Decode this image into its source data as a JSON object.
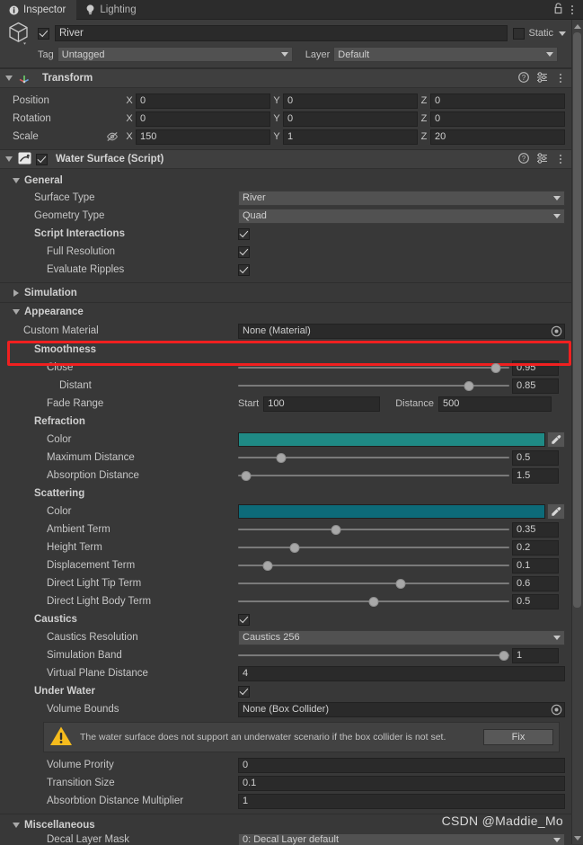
{
  "tabs": [
    {
      "label": "Inspector",
      "icon": "info-icon",
      "active": true
    },
    {
      "label": "Lighting",
      "icon": "bulb-icon",
      "active": false
    }
  ],
  "tabbar": {
    "lock_icon": "lock-icon",
    "menu_icon": "kebab-menu-icon"
  },
  "object_header": {
    "icon": "gameobject-cube-icon",
    "enabled": true,
    "name": "River",
    "static_label": "Static",
    "static_checked": false,
    "tag_label": "Tag",
    "tag_value": "Untagged",
    "layer_label": "Layer",
    "layer_value": "Default"
  },
  "transform": {
    "title": "Transform",
    "icon": "transform-axes-icon",
    "help_icon": "help-icon",
    "preset_icon": "preset-icon",
    "menu_icon": "kebab-menu-icon",
    "rows": [
      {
        "label": "Position",
        "x": "0",
        "y": "0",
        "z": "0",
        "locked_icon": false
      },
      {
        "label": "Rotation",
        "x": "0",
        "y": "0",
        "z": "0",
        "locked_icon": false
      },
      {
        "label": "Scale",
        "x": "150",
        "y": "1",
        "z": "20",
        "locked_icon": true
      }
    ],
    "axes": [
      "X",
      "Y",
      "Z"
    ]
  },
  "water_surface": {
    "title": "Water Surface (Script)",
    "icon": "script-icon",
    "enabled": true,
    "help_icon": "help-icon",
    "preset_icon": "preset-icon",
    "menu_icon": "kebab-menu-icon"
  },
  "sections": {
    "general": {
      "label": "General",
      "expanded": true,
      "surface_type": {
        "label": "Surface Type",
        "value": "River"
      },
      "geometry_type": {
        "label": "Geometry Type",
        "value": "Quad"
      },
      "script_interactions": {
        "label": "Script Interactions",
        "checked": true
      },
      "full_resolution": {
        "label": "Full Resolution",
        "checked": true
      },
      "evaluate_ripples": {
        "label": "Evaluate Ripples",
        "checked": true
      }
    },
    "simulation": {
      "label": "Simulation",
      "expanded": false
    },
    "appearance": {
      "label": "Appearance",
      "expanded": true,
      "custom_material": {
        "label": "Custom Material",
        "value": "None (Material)",
        "highlighted": true
      },
      "smoothness": {
        "label": "Smoothness",
        "close": {
          "label": "Close",
          "value": "0.95",
          "percent": 95
        },
        "distant": {
          "label": "Distant",
          "value": "0.85",
          "percent": 85
        },
        "fade_range": {
          "label": "Fade Range",
          "start_label": "Start",
          "start_value": "100",
          "distance_label": "Distance",
          "distance_value": "500"
        }
      },
      "refraction": {
        "label": "Refraction",
        "color": {
          "label": "Color",
          "hex": "#1f8a85",
          "eyedropper_icon": "eyedropper-icon"
        },
        "maximum_distance": {
          "label": "Maximum Distance",
          "value": "0.5",
          "percent": 16
        },
        "absorption_distance": {
          "label": "Absorption Distance",
          "value": "1.5",
          "percent": 3
        }
      },
      "scattering": {
        "label": "Scattering",
        "color": {
          "label": "Color",
          "hex": "#0d6b79",
          "eyedropper_icon": "eyedropper-icon"
        },
        "ambient_term": {
          "label": "Ambient Term",
          "value": "0.35",
          "percent": 36
        },
        "height_term": {
          "label": "Height Term",
          "value": "0.2",
          "percent": 21
        },
        "displacement_term": {
          "label": "Displacement Term",
          "value": "0.1",
          "percent": 11
        },
        "direct_light_tip_term": {
          "label": "Direct Light Tip Term",
          "value": "0.6",
          "percent": 60
        },
        "direct_light_body_term": {
          "label": "Direct Light Body Term",
          "value": "0.5",
          "percent": 50
        }
      },
      "caustics": {
        "label": "Caustics",
        "checked": true,
        "resolution": {
          "label": "Caustics Resolution",
          "value": "Caustics 256"
        },
        "simulation_band": {
          "label": "Simulation Band",
          "value": "1",
          "percent": 98
        },
        "virtual_plane_distance": {
          "label": "Virtual Plane Distance",
          "value": "4"
        }
      },
      "under_water": {
        "label": "Under Water",
        "checked": true,
        "volume_bounds": {
          "label": "Volume Bounds",
          "value": "None (Box Collider)"
        },
        "warning": {
          "icon": "warning-icon",
          "text": "The water surface does not support an underwater scenario if the box collider is not set.",
          "button_label": "Fix"
        },
        "volume_priority": {
          "label": "Volume Prority",
          "value": "0"
        },
        "transition_size": {
          "label": "Transition Size",
          "value": "0.1"
        },
        "absorption_distance_multiplier": {
          "label": "Absorbtion Distance Multiplier",
          "value": "1"
        }
      }
    },
    "miscellaneous": {
      "label": "Miscellaneous",
      "expanded": true,
      "decal_layer_mask": {
        "label": "Decal Layer Mask",
        "value": "0: Decal Layer default"
      }
    }
  },
  "watermark": "CSDN @Maddie_Mo"
}
